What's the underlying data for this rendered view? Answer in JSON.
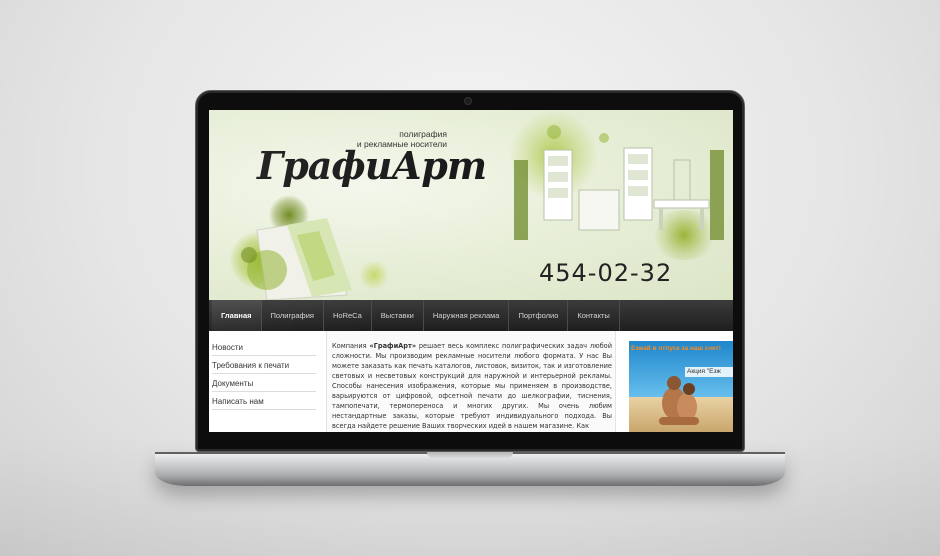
{
  "site": {
    "logo": "ГрафиАрт",
    "tagline_line1": "полиграфия",
    "tagline_line2": "и рекламные носители",
    "phone": "454-02-32"
  },
  "nav": {
    "items": [
      {
        "label": "Главная",
        "active": true
      },
      {
        "label": "Полиграфия",
        "active": false
      },
      {
        "label": "HoReCa",
        "active": false
      },
      {
        "label": "Выставки",
        "active": false
      },
      {
        "label": "Наружная реклама",
        "active": false
      },
      {
        "label": "Портфолио",
        "active": false
      },
      {
        "label": "Контакты",
        "active": false
      }
    ]
  },
  "sidebar": {
    "items": [
      {
        "label": "Новости"
      },
      {
        "label": "Требования к печати"
      },
      {
        "label": "Документы"
      },
      {
        "label": "Написать нам"
      }
    ]
  },
  "content": {
    "intro_before": "Компания ",
    "intro_brand": "«ГрафиАрт»",
    "intro_after": " решает весь комплекс полиграфических задач любой сложности. Мы производим рекламные носители любого формата. У нас Вы можете заказать как печать каталогов, листовок, визиток, так и изготовление световых и несветовых конструкций для наружной и интерьерной рекламы. Способы нанесения изображения, которые мы применяем в производстве, варьируются от цифровой, офсетной печати до шелкографии, тиснения, тампопечати, термопереноса и многих других. Мы очень любим нестандартные заказы, которые требуют индивидуального подхода. Вы всегда найдете решение Ваших творческих идей в нашем магазине. Как"
  },
  "banner": {
    "title": "Езжай в отпуск за наш счет!",
    "subtitle": "Акция \"Езж"
  },
  "colors": {
    "header_green": "#dbe5c6",
    "nav_dark": "#1e1e1e",
    "banner_orange": "#ff8a1a",
    "accent_lime": "#a9c23a"
  }
}
